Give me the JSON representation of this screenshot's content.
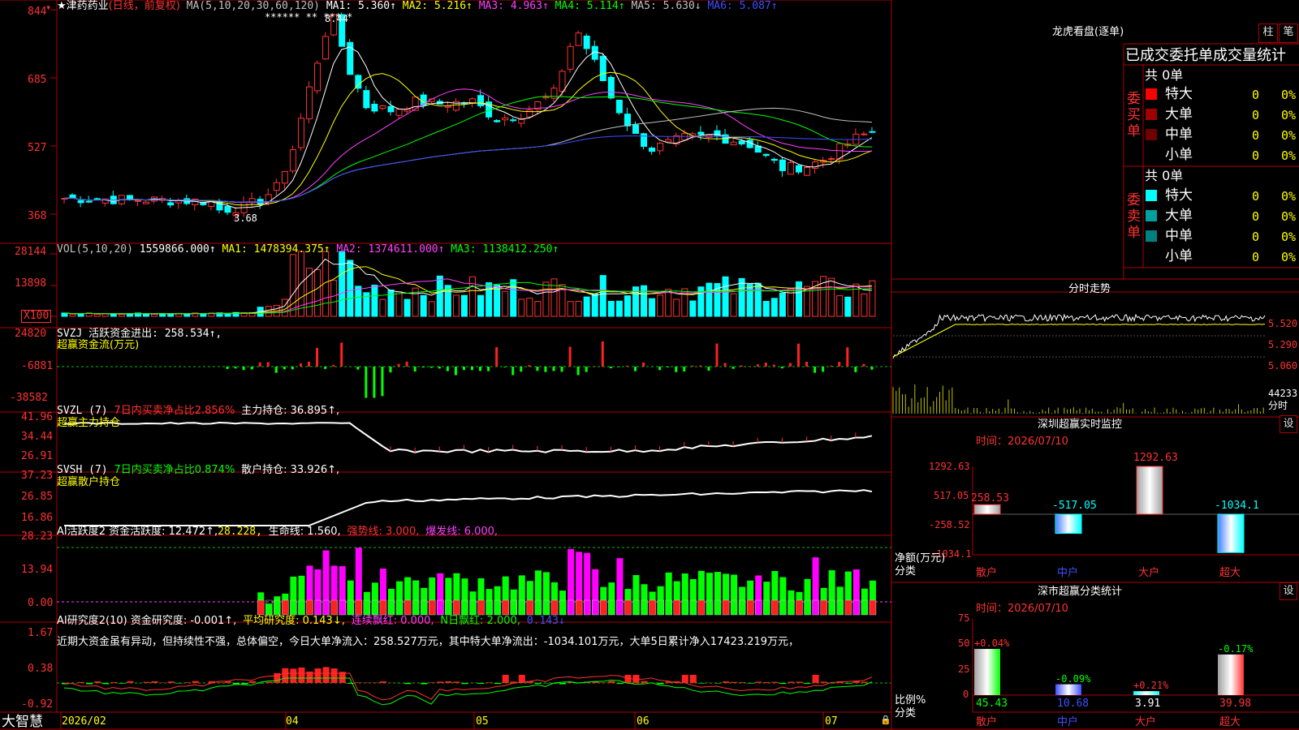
{
  "main": {
    "stock_name": "★津药药业",
    "period": "(日线，前复权)",
    "ma_label": "MA(5,10,20,30,60,120)",
    "ma_values": [
      {
        "text": "MA1: 5.360↑",
        "color": "#ffffff"
      },
      {
        "text": "MA2: 5.216↑",
        "color": "#ffff00"
      },
      {
        "text": "MA3: 4.963↑",
        "color": "#ff40ff"
      },
      {
        "text": "MA4: 5.114↑",
        "color": "#00ff00"
      },
      {
        "text": "MA5: 5.630↓",
        "color": "#c0c0c0"
      },
      {
        "text": "MA6: 5.087↑",
        "color": "#3c50ff"
      }
    ],
    "y_labels": [
      "844",
      "685",
      "527",
      "368"
    ],
    "high_label": "8.44",
    "low_label": "3.68",
    "stars": "******  **  ***      *"
  },
  "vol": {
    "title": "VOL(5,10,20)",
    "value": "1559866.000↑",
    "ma1": "MA1: 1478394.375↑",
    "ma2": "MA2: 1374611.000↑",
    "ma3": "MA3: 1138412.250↑",
    "y_labels": [
      "28144",
      "13898"
    ],
    "unit": "X100"
  },
  "svzj": {
    "title": "SVZJ  活跃资金进出: 258.534↑,",
    "subtitle": "超赢资金流(万元)",
    "y_labels": [
      "24820",
      "-6881",
      "-38582"
    ]
  },
  "svzl": {
    "title": "SVZL (7)",
    "ratio": "7日内买卖净占比2.856%",
    "hold": "主力持仓: 36.895↑,",
    "subtitle": "超赢主力持仓",
    "y_labels": [
      "41.96",
      "34.44",
      "26.91"
    ]
  },
  "svsh": {
    "title": "SVSH (7)",
    "ratio": "7日内买卖净占比0.874%",
    "hold": "散户持仓: 33.926↑,",
    "subtitle": "超赢散户持仓",
    "y_labels": [
      "37.23",
      "26.85",
      "16.86"
    ]
  },
  "ai1": {
    "title": "AI活跃度2 资金活跃度: 12.472↑,",
    "v2": "28.228,",
    "life": "生命线: 1.560,",
    "strong": "强势线: 3.000,",
    "burst": "爆发线: 6.000,",
    "y_labels": [
      "28.23",
      "13.94",
      "0.00"
    ]
  },
  "ai2": {
    "title": "AI研究度2(10) 资金研究度: -0.001↑,",
    "avg": "平均研究度: 0.143↓,",
    "cont": "连续飘红: 0.000,",
    "nday": "N日飘红: 2.000,",
    "last": "0.143↓",
    "comment": "近期大资金虽有异动，但持续性不强，总体偏空，今日大单净流入：258.527万元，其中特大单净流出：-1034.101万元，大单5日累计净入17423.219万元，",
    "y_labels": [
      "1.67",
      "0.38",
      "-0.92"
    ]
  },
  "bottom": {
    "logo": "大智慧",
    "dates": [
      "2026/02",
      "04",
      "05",
      "06",
      "07"
    ]
  },
  "longhu": {
    "title": "龙虎看盘(逐单)",
    "btn1": "柱",
    "btn2": "笔",
    "header": "已成交委托单成交量统计",
    "buy_total": "共 0单",
    "buy_label": "委买单",
    "sell_total": "共 0单",
    "sell_label": "委卖单",
    "buy_rows": [
      {
        "name": "特大",
        "val": "0",
        "pct": "0%",
        "color": "#ff0000"
      },
      {
        "name": "大单",
        "val": "0",
        "pct": "0%",
        "color": "#a00000"
      },
      {
        "name": "中单",
        "val": "0",
        "pct": "0%",
        "color": "#700000"
      },
      {
        "name": "小单",
        "val": "0",
        "pct": "0%",
        "color": ""
      }
    ],
    "sell_rows": [
      {
        "name": "特大",
        "val": "0",
        "pct": "0%",
        "color": "#00ffff"
      },
      {
        "name": "大单",
        "val": "0",
        "pct": "0%",
        "color": "#00a0a0"
      },
      {
        "name": "中单",
        "val": "0",
        "pct": "0%",
        "color": "#008080"
      },
      {
        "name": "小单",
        "val": "0",
        "pct": "0%",
        "color": ""
      }
    ]
  },
  "fenshi": {
    "title": "分时走势",
    "y_labels": [
      "5.520",
      "5.290",
      "5.060"
    ],
    "vol_label": "44233",
    "unit": "分时"
  },
  "sz_monitor": {
    "title": "深圳超赢实时监控",
    "btn": "设",
    "time": "时间：2026/07/10",
    "y_labels": [
      "1292.63",
      "517.05",
      "-258.52",
      "-1034.1"
    ],
    "ylabel": "净额(万元)",
    "xlabel": "分类",
    "bars": [
      {
        "cat": "散户",
        "value": 258.53,
        "label": "258.53"
      },
      {
        "cat": "中户",
        "value": -517.05,
        "label": "-517.05"
      },
      {
        "cat": "大户",
        "value": 1292.63,
        "label": "1292.63"
      },
      {
        "cat": "超大",
        "value": -1034.1,
        "label": "-1034.1"
      }
    ]
  },
  "sz_class": {
    "title": "深市超赢分类统计",
    "btn": "设",
    "time": "时间：2026/07/10",
    "y_labels": [
      "75",
      "50",
      "25",
      "0"
    ],
    "ylabel": "比例%",
    "xlabel": "分类",
    "bars": [
      {
        "cat": "散户",
        "value": 45.43,
        "label": "45.43",
        "chg": "+0.04%"
      },
      {
        "cat": "中户",
        "value": 10.68,
        "label": "10.68",
        "chg": "-0.09%"
      },
      {
        "cat": "大户",
        "value": 3.91,
        "label": "3.91",
        "chg": "+0.21%"
      },
      {
        "cat": "超大",
        "value": 39.98,
        "label": "39.98",
        "chg": "-0.17%"
      }
    ]
  }
}
